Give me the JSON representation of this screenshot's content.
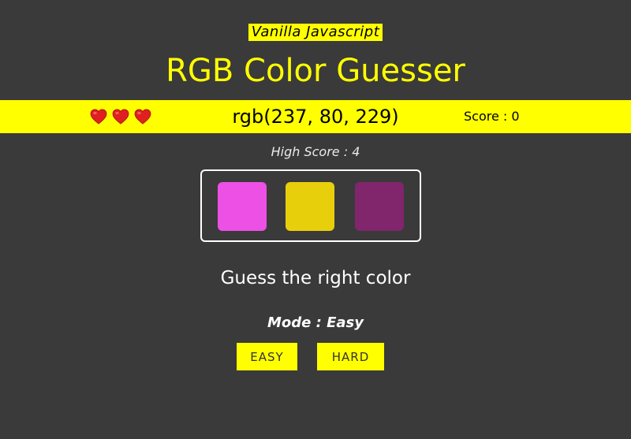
{
  "header": {
    "tagline": "Vanilla Javascript",
    "title": "RGB Color Guesser"
  },
  "status": {
    "lives": 3,
    "rgb": "rgb(237, 80, 229)",
    "score": "Score : 0"
  },
  "high_score": "High Score : 4",
  "options": [
    {
      "color": "#ed50e5"
    },
    {
      "color": "#e8cf0b"
    },
    {
      "color": "#81256c"
    }
  ],
  "prompt": "Guess the right color",
  "mode": "Mode : Easy",
  "buttons": {
    "easy": "EASY",
    "hard": "HARD"
  },
  "colors": {
    "background": "#3a3a3a",
    "accent": "#ffff00",
    "heart": "#e02020"
  }
}
